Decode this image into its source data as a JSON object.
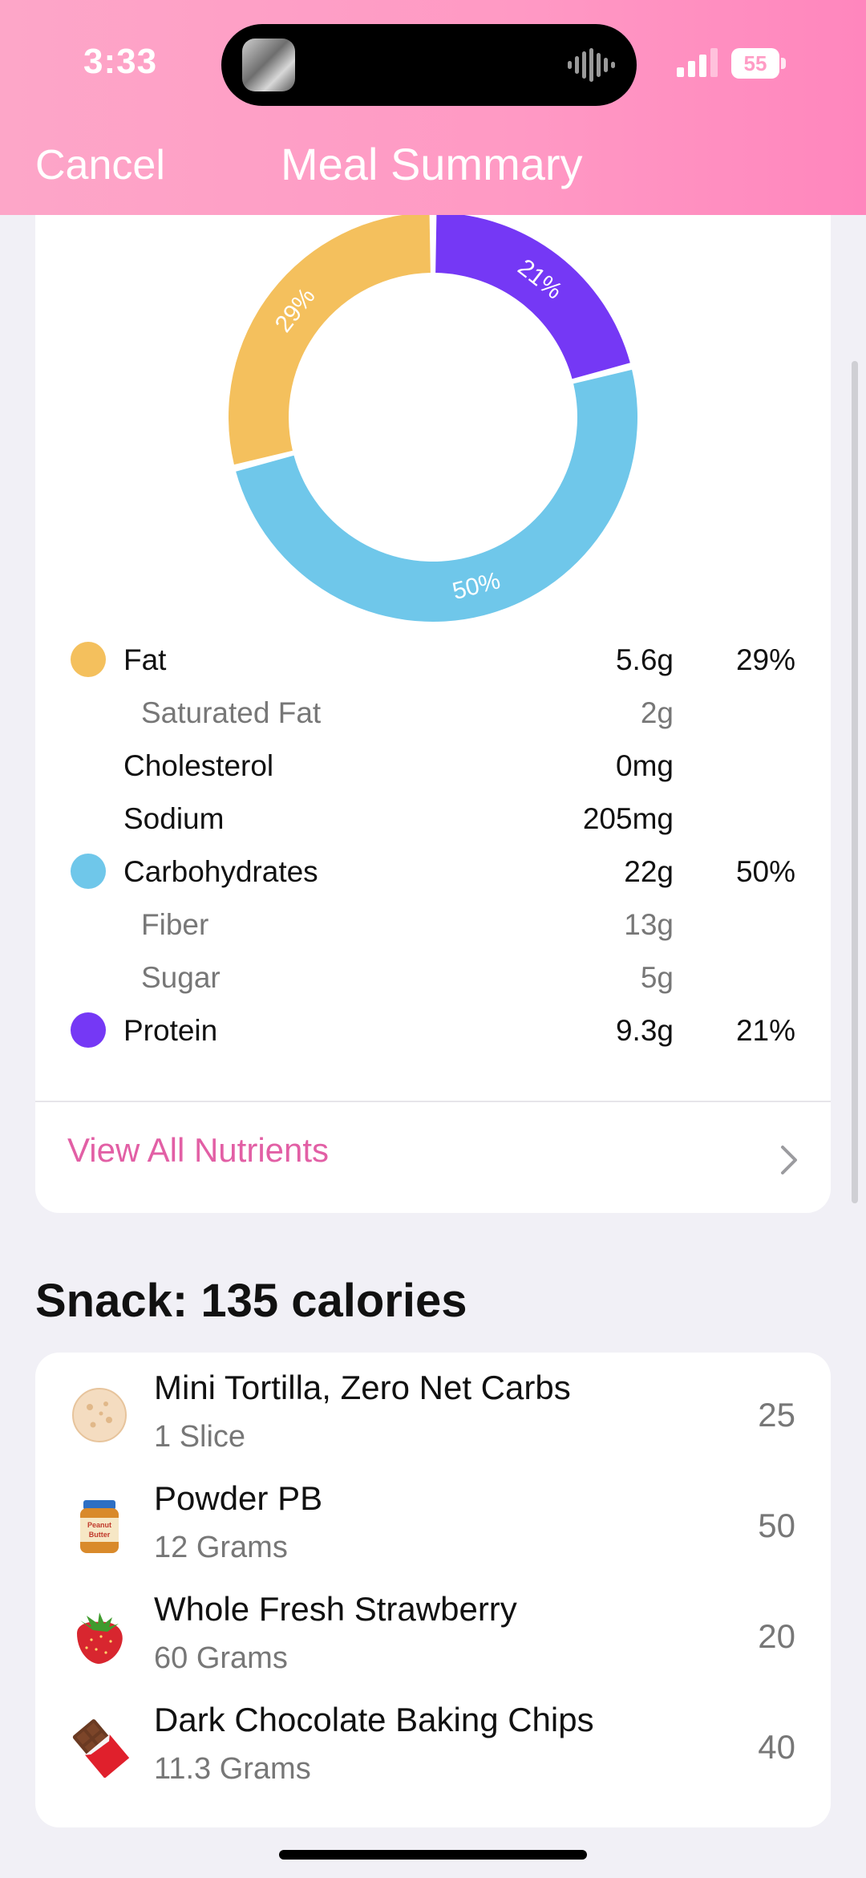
{
  "status_bar": {
    "time": "3:33",
    "battery": "55"
  },
  "nav": {
    "cancel_label": "Cancel",
    "title": "Meal Summary"
  },
  "chart_data": {
    "type": "pie",
    "donut": true,
    "slices": [
      {
        "label": "Protein",
        "value": 21,
        "display": "21%",
        "color": "#7538f5"
      },
      {
        "label": "Carbohydrates",
        "value": 50,
        "display": "50%",
        "color": "#6fc7ea"
      },
      {
        "label": "Fat",
        "value": 29,
        "display": "29%",
        "color": "#f4c05d"
      }
    ]
  },
  "nutrients": [
    {
      "name": "Fat",
      "amount": "5.6g",
      "percent": "29%",
      "color": "#f4c05d",
      "sub": false
    },
    {
      "name": "Saturated Fat",
      "amount": "2g",
      "percent": "",
      "color": "",
      "sub": true
    },
    {
      "name": "Cholesterol",
      "amount": "0mg",
      "percent": "",
      "color": "",
      "sub": false
    },
    {
      "name": "Sodium",
      "amount": "205mg",
      "percent": "",
      "color": "",
      "sub": false
    },
    {
      "name": "Carbohydrates",
      "amount": "22g",
      "percent": "50%",
      "color": "#6fc7ea",
      "sub": false
    },
    {
      "name": "Fiber",
      "amount": "13g",
      "percent": "",
      "color": "",
      "sub": true
    },
    {
      "name": "Sugar",
      "amount": "5g",
      "percent": "",
      "color": "",
      "sub": true
    },
    {
      "name": "Protein",
      "amount": "9.3g",
      "percent": "21%",
      "color": "#7538f5",
      "sub": false
    }
  ],
  "view_all_label": "View All Nutrients",
  "snack": {
    "heading": "Snack: 135 calories",
    "items": [
      {
        "name": "Mini Tortilla, Zero Net Carbs",
        "amount": "1 Slice",
        "calories": "25",
        "icon": "tortilla-icon"
      },
      {
        "name": "Powder PB",
        "amount": "12 Grams",
        "calories": "50",
        "icon": "peanut-butter-jar-icon",
        "icon_text": "Peanut Butter"
      },
      {
        "name": "Whole Fresh Strawberry",
        "amount": "60 Grams",
        "calories": "20",
        "icon": "strawberry-icon"
      },
      {
        "name": "Dark Chocolate Baking Chips",
        "amount": "11.3 Grams",
        "calories": "40",
        "icon": "chocolate-bar-icon"
      }
    ]
  },
  "colors": {
    "header_pink": "#ff99c4",
    "accent_link": "#e25fa5"
  }
}
